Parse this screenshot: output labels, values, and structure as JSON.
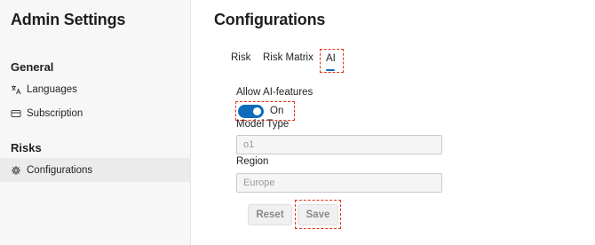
{
  "sidebar": {
    "title": "Admin Settings",
    "sections": [
      {
        "header": "General",
        "items": [
          {
            "label": "Languages",
            "icon": "translate-icon"
          },
          {
            "label": "Subscription",
            "icon": "credit-card-icon"
          }
        ]
      },
      {
        "header": "Risks",
        "items": [
          {
            "label": "Configurations",
            "icon": "gear-icon",
            "selected": true
          }
        ]
      }
    ]
  },
  "main": {
    "title": "Configurations",
    "tabs": [
      {
        "label": "Risk"
      },
      {
        "label": "Risk Matrix"
      },
      {
        "label": "AI",
        "active": true
      }
    ],
    "ai_features": {
      "label": "Allow AI-features",
      "toggle_state": "On",
      "enabled": true
    },
    "model_type": {
      "label": "Model Type",
      "value": "o1"
    },
    "region": {
      "label": "Region",
      "value": "Europe"
    },
    "buttons": {
      "reset": "Reset",
      "save": "Save"
    }
  },
  "colors": {
    "accent": "#0f6cbd",
    "highlight_outline": "#e0341b",
    "sidebar_bg": "#f7f7f7",
    "selected_bg": "#ebebeb"
  }
}
